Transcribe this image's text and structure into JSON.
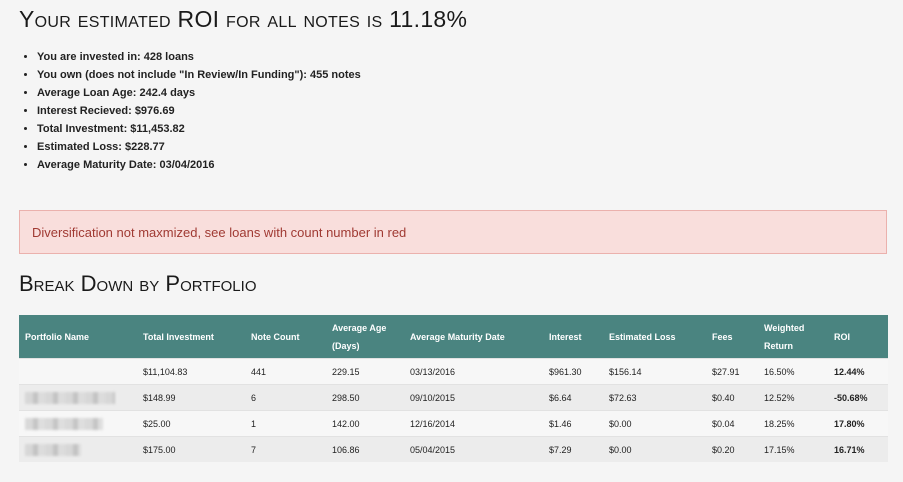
{
  "title": "Your estimated ROI for all notes is 11.18%",
  "stats": [
    "You are invested in: 428 loans",
    "You own (does not include \"In Review/In Funding\"): 455 notes",
    "Average Loan Age: 242.4 days",
    "Interest Recieved: $976.69",
    "Total Investment: $11,453.82",
    "Estimated Loss: $228.77",
    "Average Maturity Date: 03/04/2016"
  ],
  "alert": "Diversification not maxmized, see loans with count number in red",
  "breakdown_title": "Break Down by Portfolio",
  "table": {
    "headers": [
      "Portfolio Name",
      "Total Investment",
      "Note Count",
      "Average Age (Days)",
      "Average Maturity Date",
      "Interest",
      "Estimated Loss",
      "Fees",
      "Weighted Return",
      "ROI"
    ],
    "rows": [
      {
        "name": "",
        "total": "$11,104.83",
        "count": "441",
        "age": "229.15",
        "maturity": "03/13/2016",
        "interest": "$961.30",
        "loss": "$156.14",
        "fees": "$27.91",
        "weighted": "16.50%",
        "roi": "12.44%"
      },
      {
        "name": "",
        "total": "$148.99",
        "count": "6",
        "age": "298.50",
        "maturity": "09/10/2015",
        "interest": "$6.64",
        "loss": "$72.63",
        "fees": "$0.40",
        "weighted": "12.52%",
        "roi": "-50.68%"
      },
      {
        "name": "",
        "total": "$25.00",
        "count": "1",
        "age": "142.00",
        "maturity": "12/16/2014",
        "interest": "$1.46",
        "loss": "$0.00",
        "fees": "$0.04",
        "weighted": "18.25%",
        "roi": "17.80%"
      },
      {
        "name": "",
        "total": "$175.00",
        "count": "7",
        "age": "106.86",
        "maturity": "05/04/2015",
        "interest": "$7.29",
        "loss": "$0.00",
        "fees": "$0.20",
        "weighted": "17.15%",
        "roi": "16.71%"
      }
    ]
  }
}
